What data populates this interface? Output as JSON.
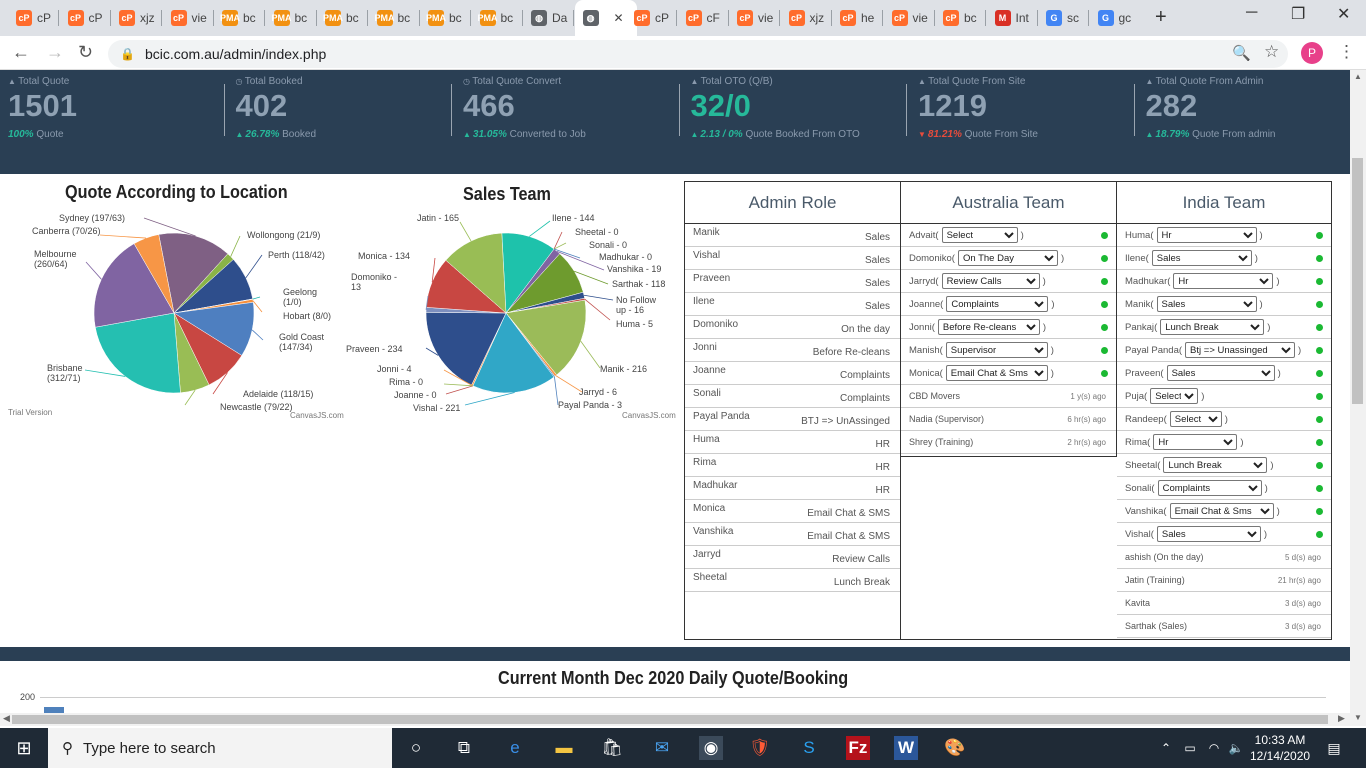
{
  "browser": {
    "tabs": [
      {
        "label": "cP",
        "icon": "cpanel-icon",
        "color": "#ff6c2c"
      },
      {
        "label": "cP",
        "icon": "cpanel-icon",
        "color": "#ff6c2c"
      },
      {
        "label": "xjz",
        "icon": "cpanel-icon",
        "color": "#ff6c2c"
      },
      {
        "label": "vie",
        "icon": "cpanel-icon",
        "color": "#ff6c2c"
      },
      {
        "label": "bc",
        "icon": "phpmyadmin-icon",
        "color": "#f29111"
      },
      {
        "label": "bc",
        "icon": "phpmyadmin-icon",
        "color": "#f29111"
      },
      {
        "label": "bc",
        "icon": "phpmyadmin-icon",
        "color": "#f29111"
      },
      {
        "label": "bc",
        "icon": "phpmyadmin-icon",
        "color": "#f29111"
      },
      {
        "label": "bc",
        "icon": "phpmyadmin-icon",
        "color": "#f29111"
      },
      {
        "label": "bc",
        "icon": "phpmyadmin-icon",
        "color": "#f29111"
      },
      {
        "label": "Da",
        "icon": "globe-icon",
        "color": "#5f6368"
      },
      {
        "label": "",
        "icon": "globe-icon",
        "color": "#5f6368",
        "active": true
      },
      {
        "label": "cP",
        "icon": "cpanel-icon",
        "color": "#ff6c2c"
      },
      {
        "label": "cF",
        "icon": "cpanel-icon",
        "color": "#ff6c2c"
      },
      {
        "label": "vie",
        "icon": "cpanel-icon",
        "color": "#ff6c2c"
      },
      {
        "label": "xjz",
        "icon": "cpanel-icon",
        "color": "#ff6c2c"
      },
      {
        "label": "he",
        "icon": "cpanel-icon",
        "color": "#ff6c2c"
      },
      {
        "label": "vie",
        "icon": "cpanel-icon",
        "color": "#ff6c2c"
      },
      {
        "label": "bc",
        "icon": "cpanel-icon",
        "color": "#ff6c2c"
      },
      {
        "label": "Int",
        "icon": "gmail-icon",
        "color": "#d93025"
      },
      {
        "label": "sc",
        "icon": "google-icon",
        "color": "#4285f4"
      },
      {
        "label": "gc",
        "icon": "google-icon",
        "color": "#4285f4"
      }
    ],
    "url": "bcic.com.au/admin/index.php",
    "profile_initial": "P"
  },
  "stats": [
    {
      "label": "Total Quote",
      "value": "1501",
      "pct": "100%",
      "sub": "Quote",
      "arrow": "",
      "color": "#8fa1b3",
      "pct_color": "#26b99a"
    },
    {
      "label": "Total Booked",
      "value": "402",
      "pct": "26.78%",
      "sub": "Booked",
      "arrow": "up",
      "color": "#8fa1b3",
      "pct_color": "#26b99a"
    },
    {
      "label": "Total Quote Convert",
      "value": "466",
      "pct": "31.05%",
      "sub": "Converted to Job",
      "arrow": "up",
      "color": "#8fa1b3",
      "pct_color": "#26b99a"
    },
    {
      "label": "Total OTO (Q/B)",
      "value": "32/0",
      "pct": "2.13 / 0%",
      "sub": "Quote Booked From OTO",
      "arrow": "up",
      "color": "#26b99a",
      "pct_color": "#26b99a"
    },
    {
      "label": "Total Quote From Site",
      "value": "1219",
      "pct": "81.21%",
      "sub": "Quote From Site",
      "arrow": "down",
      "color": "#8fa1b3",
      "pct_color": "#e74c3c"
    },
    {
      "label": "Total Quote From Admin",
      "value": "282",
      "pct": "18.79%",
      "sub": "Quote From admin",
      "arrow": "up",
      "color": "#8fa1b3",
      "pct_color": "#26b99a"
    }
  ],
  "chart_data": [
    {
      "type": "pie",
      "title": "Quote According to Location",
      "series": [
        {
          "name": "Sydney",
          "label": "Sydney (197/63)",
          "value": 197,
          "color": "#7f6084"
        },
        {
          "name": "Wollongong",
          "label": "Wollongong (21/9)",
          "value": 21,
          "color": "#8ab447"
        },
        {
          "name": "Perth",
          "label": "Perth (118/42)",
          "value": 118,
          "color": "#2e4e8c"
        },
        {
          "name": "Geelong",
          "label": "Geelong (1/0)",
          "value": 1,
          "color": "#1ab2a8"
        },
        {
          "name": "Hobart",
          "label": "Hobart (8/0)",
          "value": 8,
          "color": "#f78f3b"
        },
        {
          "name": "Gold Coast",
          "label": "Gold Coast (147/34)",
          "value": 147,
          "color": "#4e7fc0"
        },
        {
          "name": "Adelaide",
          "label": "Adelaide (118/15)",
          "value": 118,
          "color": "#c84742"
        },
        {
          "name": "Newcastle",
          "label": "Newcastle (79/22)",
          "value": 79,
          "color": "#99bd55"
        },
        {
          "name": "Brisbane",
          "label": "Brisbane (312/71)",
          "value": 312,
          "color": "#25bfb1"
        },
        {
          "name": "Melbourne",
          "label": "Melbourne (260/64)",
          "value": 260,
          "color": "#8064a2"
        },
        {
          "name": "Canberra",
          "label": "Canberra (70/26)",
          "value": 70,
          "color": "#f79646"
        }
      ],
      "watermark_left": "Trial Version",
      "watermark_right": "CanvasJS.com"
    },
    {
      "type": "pie",
      "title": "Sales Team",
      "series": [
        {
          "name": "Ilene",
          "label": "Ilene - 144",
          "value": 144,
          "color": "#1ec2ab"
        },
        {
          "name": "Sheetal",
          "label": "Sheetal - 0",
          "value": 0,
          "color": "#c0504d"
        },
        {
          "name": "Sonali",
          "label": "Sonali - 0",
          "value": 0,
          "color": "#9bbb59"
        },
        {
          "name": "Madhukar",
          "label": "Madhukar - 0",
          "value": 0,
          "color": "#4f81bd"
        },
        {
          "name": "Vanshika",
          "label": "Vanshika - 19",
          "value": 19,
          "color": "#8064a2"
        },
        {
          "name": "Sarthak",
          "label": "Sarthak - 118",
          "value": 118,
          "color": "#6e9b2e"
        },
        {
          "name": "No Follow up",
          "label": "No Follow up - 16",
          "value": 16,
          "color": "#2e4e8c"
        },
        {
          "name": "Huma",
          "label": "Huma - 5",
          "value": 5,
          "color": "#c0504d"
        },
        {
          "name": "Manik",
          "label": "Manik - 216",
          "value": 216,
          "color": "#9bbb59"
        },
        {
          "name": "Jarryd",
          "label": "Jarryd - 6",
          "value": 6,
          "color": "#f79646"
        },
        {
          "name": "Payal Panda",
          "label": "Payal Panda - 3",
          "value": 3,
          "color": "#4f81bd"
        },
        {
          "name": "Vishal",
          "label": "Vishal - 221",
          "value": 221,
          "color": "#30a7c7"
        },
        {
          "name": "Joanne",
          "label": "Joanne - 0",
          "value": 0,
          "color": "#c0504d"
        },
        {
          "name": "Rima",
          "label": "Rima - 0",
          "value": 0,
          "color": "#9bbb59"
        },
        {
          "name": "Jonni",
          "label": "Jonni - 4",
          "value": 4,
          "color": "#f79646"
        },
        {
          "name": "Praveen",
          "label": "Praveen - 234",
          "value": 234,
          "color": "#2e4e8c"
        },
        {
          "name": "Domoniko",
          "label": "Domoniko - 13",
          "value": 13,
          "color": "#7d8fbf"
        },
        {
          "name": "Monica",
          "label": "Monica - 134",
          "value": 134,
          "color": "#c84742"
        },
        {
          "name": "Jatin",
          "label": "Jatin - 165",
          "value": 165,
          "color": "#99bd55"
        }
      ],
      "watermark_right": "CanvasJS.com"
    }
  ],
  "teams": {
    "admin": {
      "title": "Admin Role",
      "rows": [
        {
          "name": "Manik",
          "role": "Sales"
        },
        {
          "name": "Vishal",
          "role": "Sales"
        },
        {
          "name": "Praveen",
          "role": "Sales"
        },
        {
          "name": "Ilene",
          "role": "Sales"
        },
        {
          "name": "Domoniko",
          "role": "On the day"
        },
        {
          "name": "Jonni",
          "role": "Before Re-cleans"
        },
        {
          "name": "Joanne",
          "role": "Complaints"
        },
        {
          "name": "Sonali",
          "role": "Complaints"
        },
        {
          "name": "Payal Panda",
          "role": "BTJ => UnAssinged"
        },
        {
          "name": "Huma",
          "role": "HR"
        },
        {
          "name": "Rima",
          "role": "HR"
        },
        {
          "name": "Madhukar",
          "role": "HR"
        },
        {
          "name": "Monica",
          "role": "Email Chat & SMS"
        },
        {
          "name": "Vanshika",
          "role": "Email Chat & SMS"
        },
        {
          "name": "Jarryd",
          "role": "Review Calls"
        },
        {
          "name": "Sheetal",
          "role": "Lunch Break"
        }
      ]
    },
    "australia": {
      "title": "Australia Team",
      "rows": [
        {
          "name": "Advait",
          "select": "Select",
          "sel_w": 76
        },
        {
          "name": "Domoniko",
          "select": "On The Day",
          "sel_w": 100
        },
        {
          "name": "Jarryd",
          "select": "Review Calls",
          "sel_w": 98
        },
        {
          "name": "Joanne",
          "select": "Complaints",
          "sel_w": 102
        },
        {
          "name": "Jonni",
          "select": "Before Re-cleans",
          "sel_w": 102
        },
        {
          "name": "Manish",
          "select": "Supervisor",
          "sel_w": 102
        },
        {
          "name": "Monica",
          "select": "Email Chat & Sms",
          "sel_w": 102
        }
      ],
      "offline": [
        {
          "name": "CBD Movers",
          "ago": "1 y(s) ago"
        },
        {
          "name": "Nadia (Supervisor)",
          "ago": "6 hr(s) ago"
        },
        {
          "name": "Shrey (Training)",
          "ago": "2 hr(s) ago"
        }
      ]
    },
    "india": {
      "title": "India Team",
      "rows": [
        {
          "name": "Huma",
          "select": "Hr",
          "sel_w": 100
        },
        {
          "name": "Ilene",
          "select": "Sales",
          "sel_w": 100
        },
        {
          "name": "Madhukar",
          "select": "Hr",
          "sel_w": 100
        },
        {
          "name": "Manik",
          "select": "Sales",
          "sel_w": 100
        },
        {
          "name": "Pankaj",
          "select": "Lunch Break",
          "sel_w": 104
        },
        {
          "name": "Payal Panda",
          "select": "Btj => Unassinged",
          "sel_w": 110
        },
        {
          "name": "Praveen",
          "select": "Sales",
          "sel_w": 108
        },
        {
          "name": "Puja",
          "select": "Select",
          "sel_w": 48
        },
        {
          "name": "Randeep",
          "select": "Select",
          "sel_w": 52
        },
        {
          "name": "Rima",
          "select": "Hr",
          "sel_w": 84
        },
        {
          "name": "Sheetal",
          "select": "Lunch Break",
          "sel_w": 104
        },
        {
          "name": "Sonali",
          "select": "Complaints",
          "sel_w": 104
        },
        {
          "name": "Vanshika",
          "select": "Email Chat & Sms",
          "sel_w": 104
        },
        {
          "name": "Vishal",
          "select": "Sales",
          "sel_w": 104
        }
      ],
      "offline": [
        {
          "name": "ashish (On the day)",
          "ago": "5 d(s) ago"
        },
        {
          "name": "Jatin (Training)",
          "ago": "21 hr(s) ago"
        },
        {
          "name": "Kavita",
          "ago": "3 d(s) ago"
        },
        {
          "name": "Sarthak (Sales)",
          "ago": "3 d(s) ago"
        }
      ]
    }
  },
  "daily": {
    "title": "Current Month Dec 2020 Daily Quote/Booking",
    "axis_top": "200"
  },
  "taskbar": {
    "search_placeholder": "Type here to search",
    "time": "10:33 AM",
    "date": "12/14/2020",
    "notifications": "1"
  }
}
